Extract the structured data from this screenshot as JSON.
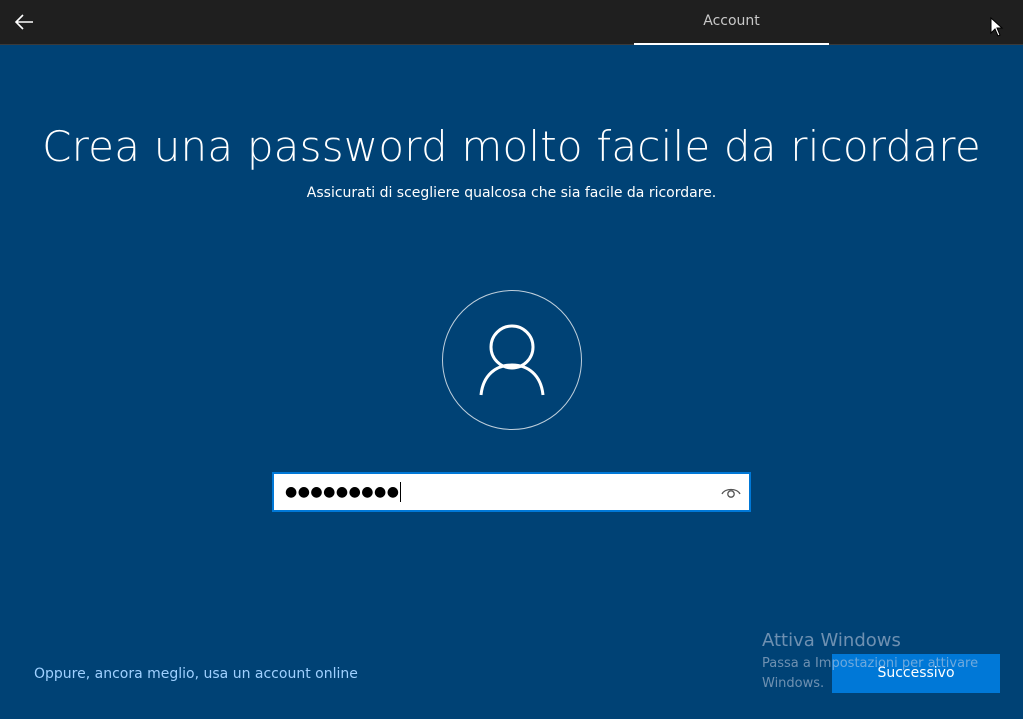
{
  "header": {
    "back_icon": "arrow-left-icon",
    "tab_label": "Account"
  },
  "main": {
    "title": "Crea una password molto facile da ricordare",
    "subtitle": "Assicurati di scegliere qualcosa che sia facile da ricordare.",
    "avatar_icon": "user-icon",
    "password_masked": "●●●●●●●●●",
    "reveal_icon": "eye-icon"
  },
  "footer": {
    "online_account_link": "Oppure, ancora meglio, usa un account online",
    "next_button": "Successivo"
  },
  "watermark": {
    "title": "Attiva Windows",
    "subtitle": "Passa a Impostazioni per attivare Windows."
  },
  "colors": {
    "background": "#004275",
    "topbar": "#1f1f1f",
    "accent": "#0078d7",
    "link": "#9fd0ff"
  }
}
